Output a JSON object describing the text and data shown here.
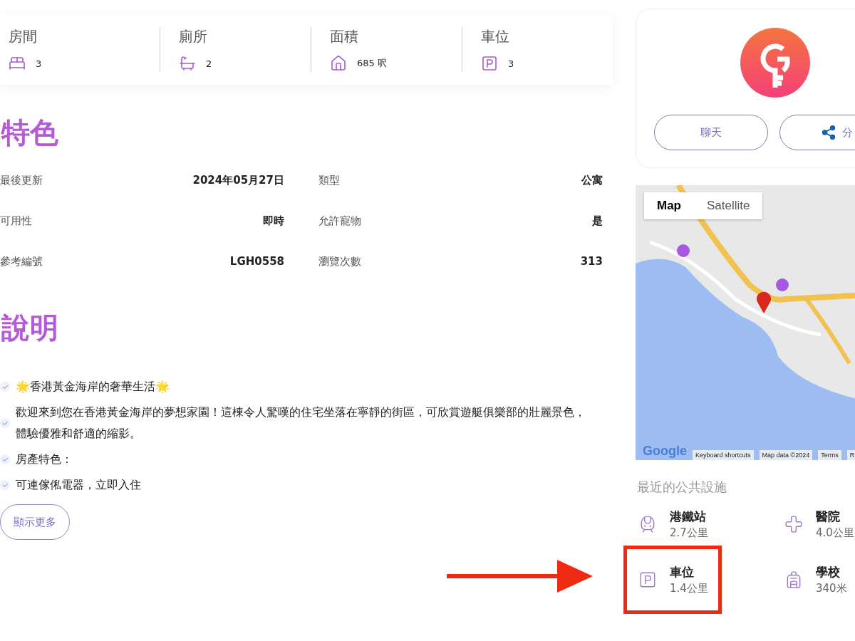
{
  "stats": [
    {
      "kind": "bed",
      "label": "房間",
      "value": "3"
    },
    {
      "kind": "bath",
      "label": "廁所",
      "value": "2"
    },
    {
      "kind": "area",
      "label": "面積",
      "value": "685 呎"
    },
    {
      "kind": "parking",
      "label": "車位",
      "value": "3"
    }
  ],
  "features": {
    "title": "特色",
    "rows": [
      {
        "label": "最後更新",
        "value": "2024年05月27日"
      },
      {
        "label": "類型",
        "value": "公寓"
      },
      {
        "label": "可用性",
        "value": "即時"
      },
      {
        "label": "允許寵物",
        "value": "是"
      },
      {
        "label": "參考編號",
        "value": "LGH0558"
      },
      {
        "label": "瀏覽次數",
        "value": "313"
      }
    ]
  },
  "description": {
    "title": "說明",
    "items": [
      "🌟香港黃金海岸的奢華生活🌟",
      "歡迎來到您在香港黃金海岸的夢想家園！這棟令人驚嘆的住宅坐落在寧靜的街區，可欣賞遊艇俱樂部的壯麗景色，體驗優雅和舒適的縮影。",
      "房產特色：",
      "可連傢俬電器，立即入住"
    ],
    "more_button": "顯示更多"
  },
  "agent_card": {
    "buttons": [
      {
        "kind": "chat",
        "label": "聊天"
      },
      {
        "kind": "share",
        "label": "分"
      }
    ]
  },
  "map": {
    "tabs": [
      {
        "label": "Map",
        "selected": true
      },
      {
        "label": "Satellite",
        "selected": false
      }
    ],
    "logo": "Google",
    "footer": [
      "Keyboard shortcuts",
      "Map data ©2024",
      "Terms",
      "R"
    ]
  },
  "facilities": {
    "title": "最近的公共設施",
    "items": [
      {
        "kind": "train",
        "name": "港鐵站",
        "distance": "2.7公里",
        "highlighted": false
      },
      {
        "kind": "hospital",
        "name": "醫院",
        "distance": "4.0公里",
        "highlighted": false
      },
      {
        "kind": "parking",
        "name": "車位",
        "distance": "1.4公里",
        "highlighted": true
      },
      {
        "kind": "school",
        "name": "學校",
        "distance": "340米",
        "highlighted": false
      }
    ]
  }
}
